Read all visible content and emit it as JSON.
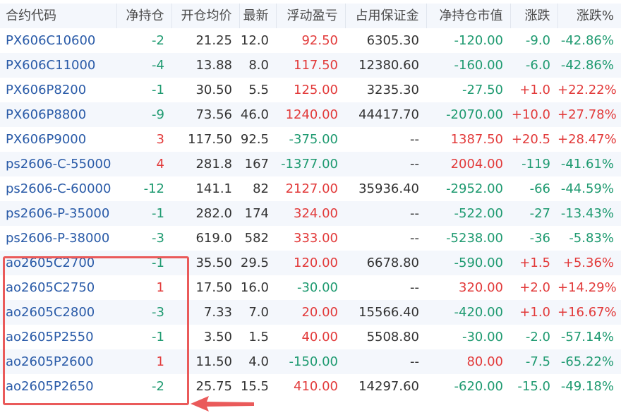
{
  "colors": {
    "up": "#e23a3a",
    "down": "#1e9a70",
    "code": "#2a5ba8",
    "header_bg": "#f4f7fc",
    "highlight": "#ea5a5a"
  },
  "columns": [
    "合约代码",
    "净持仓",
    "开仓均价",
    "最新",
    "浮动盈亏",
    "占用保证金",
    "净持仓市值",
    "涨跌",
    "涨跌%"
  ],
  "rows": [
    {
      "code": "PX606C10600",
      "net": "-2",
      "avg": "21.25",
      "last": "12.0",
      "pnl": "92.50",
      "margin": "6305.30",
      "mv": "-120.00",
      "chg": "-9.0",
      "pct": "-42.86%",
      "c": [
        "green",
        "neutral",
        "neutral",
        "red",
        "neutral",
        "green",
        "green",
        "green"
      ]
    },
    {
      "code": "PX606C11000",
      "net": "-4",
      "avg": "13.88",
      "last": "8.0",
      "pnl": "117.50",
      "margin": "12380.60",
      "mv": "-160.00",
      "chg": "-6.0",
      "pct": "-42.86%",
      "c": [
        "green",
        "neutral",
        "neutral",
        "red",
        "neutral",
        "green",
        "green",
        "green"
      ]
    },
    {
      "code": "PX606P8200",
      "net": "-1",
      "avg": "30.50",
      "last": "5.5",
      "pnl": "125.00",
      "margin": "3235.30",
      "mv": "-27.50",
      "chg": "+1.0",
      "pct": "+22.22%",
      "c": [
        "green",
        "neutral",
        "neutral",
        "red",
        "neutral",
        "green",
        "red",
        "red"
      ]
    },
    {
      "code": "PX606P8800",
      "net": "-9",
      "avg": "73.56",
      "last": "46.0",
      "pnl": "1240.00",
      "margin": "44417.70",
      "mv": "-2070.00",
      "chg": "+10.0",
      "pct": "+27.78%",
      "c": [
        "green",
        "neutral",
        "neutral",
        "red",
        "neutral",
        "green",
        "red",
        "red"
      ]
    },
    {
      "code": "PX606P9000",
      "net": "3",
      "avg": "117.50",
      "last": "92.5",
      "pnl": "-375.00",
      "margin": "--",
      "mv": "1387.50",
      "chg": "+20.5",
      "pct": "+28.47%",
      "c": [
        "red",
        "neutral",
        "neutral",
        "green",
        "neutral",
        "red",
        "red",
        "red"
      ]
    },
    {
      "code": "ps2606-C-55000",
      "net": "4",
      "avg": "281.8",
      "last": "167",
      "pnl": "-1377.00",
      "margin": "--",
      "mv": "2004.00",
      "chg": "-119",
      "pct": "-41.61%",
      "c": [
        "red",
        "neutral",
        "neutral",
        "green",
        "neutral",
        "red",
        "green",
        "green"
      ]
    },
    {
      "code": "ps2606-C-60000",
      "net": "-12",
      "avg": "141.1",
      "last": "82",
      "pnl": "2127.00",
      "margin": "35936.40",
      "mv": "-2952.00",
      "chg": "-66",
      "pct": "-44.59%",
      "c": [
        "green",
        "neutral",
        "neutral",
        "red",
        "neutral",
        "green",
        "green",
        "green"
      ]
    },
    {
      "code": "ps2606-P-35000",
      "net": "-1",
      "avg": "282.0",
      "last": "174",
      "pnl": "324.00",
      "margin": "--",
      "mv": "-522.00",
      "chg": "-27",
      "pct": "-13.43%",
      "c": [
        "green",
        "neutral",
        "neutral",
        "red",
        "neutral",
        "green",
        "green",
        "green"
      ]
    },
    {
      "code": "ps2606-P-38000",
      "net": "-3",
      "avg": "619.0",
      "last": "582",
      "pnl": "333.00",
      "margin": "--",
      "mv": "-5238.00",
      "chg": "-36",
      "pct": "-5.83%",
      "c": [
        "green",
        "neutral",
        "neutral",
        "red",
        "neutral",
        "green",
        "green",
        "green"
      ]
    },
    {
      "code": "ao2605C2700",
      "net": "-1",
      "avg": "35.50",
      "last": "29.5",
      "pnl": "120.00",
      "margin": "6678.80",
      "mv": "-590.00",
      "chg": "+1.5",
      "pct": "+5.36%",
      "c": [
        "green",
        "neutral",
        "neutral",
        "red",
        "neutral",
        "green",
        "red",
        "red"
      ]
    },
    {
      "code": "ao2605C2750",
      "net": "1",
      "avg": "17.50",
      "last": "16.0",
      "pnl": "-30.00",
      "margin": "--",
      "mv": "320.00",
      "chg": "+2.0",
      "pct": "+14.29%",
      "c": [
        "red",
        "neutral",
        "neutral",
        "green",
        "neutral",
        "red",
        "red",
        "red"
      ]
    },
    {
      "code": "ao2605C2800",
      "net": "-3",
      "avg": "7.33",
      "last": "7.0",
      "pnl": "20.00",
      "margin": "15566.40",
      "mv": "-420.00",
      "chg": "+1.0",
      "pct": "+16.67%",
      "c": [
        "green",
        "neutral",
        "neutral",
        "red",
        "neutral",
        "green",
        "red",
        "red"
      ]
    },
    {
      "code": "ao2605P2550",
      "net": "-1",
      "avg": "3.50",
      "last": "1.5",
      "pnl": "40.00",
      "margin": "5508.80",
      "mv": "-30.00",
      "chg": "-2.0",
      "pct": "-57.14%",
      "c": [
        "green",
        "neutral",
        "neutral",
        "red",
        "neutral",
        "green",
        "green",
        "green"
      ]
    },
    {
      "code": "ao2605P2600",
      "net": "1",
      "avg": "11.50",
      "last": "4.0",
      "pnl": "-150.00",
      "margin": "--",
      "mv": "80.00",
      "chg": "-7.5",
      "pct": "-65.22%",
      "c": [
        "red",
        "neutral",
        "neutral",
        "green",
        "neutral",
        "red",
        "green",
        "green"
      ]
    },
    {
      "code": "ao2605P2650",
      "net": "-2",
      "avg": "25.75",
      "last": "15.5",
      "pnl": "410.00",
      "margin": "14297.60",
      "mv": "-620.00",
      "chg": "-15.0",
      "pct": "-49.18%",
      "c": [
        "green",
        "neutral",
        "neutral",
        "red",
        "neutral",
        "green",
        "green",
        "green"
      ]
    }
  ]
}
